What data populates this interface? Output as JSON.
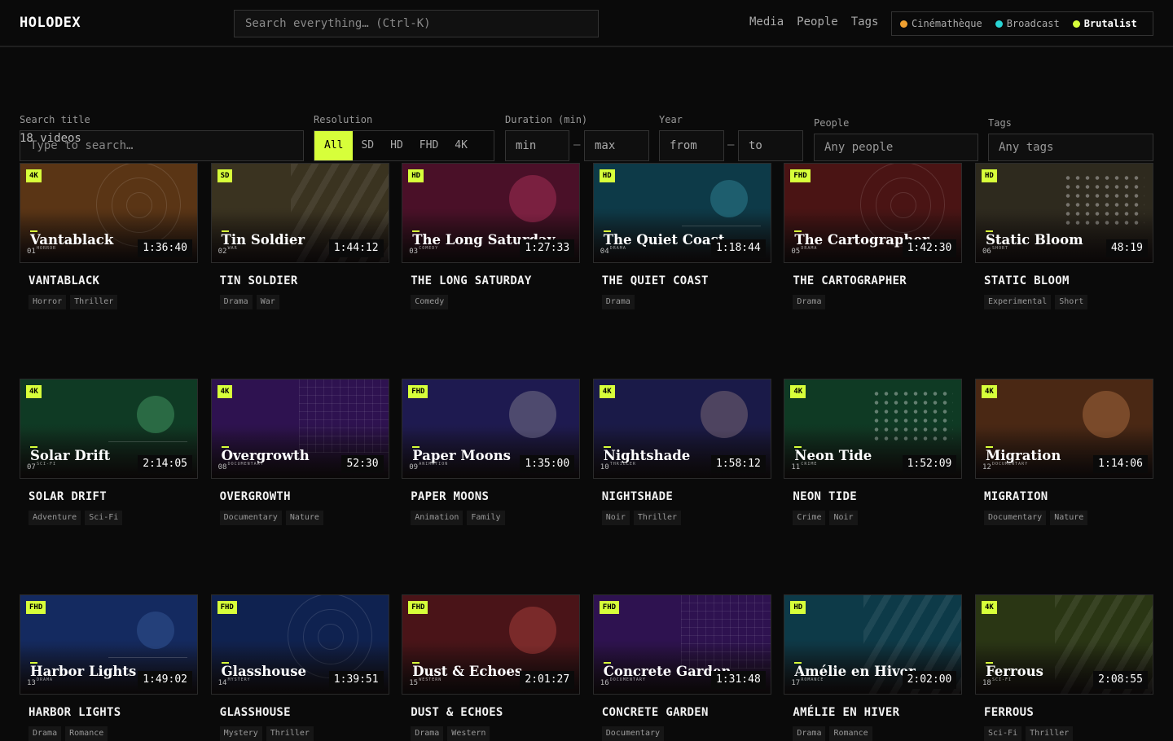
{
  "header": {
    "logo": "HOLODEX",
    "search_placeholder": "Search everything…  (Ctrl-K)",
    "nav": [
      "Media",
      "People",
      "Tags"
    ],
    "themes": [
      {
        "label": "Cinémathèque",
        "color": "#f0a030",
        "active": false
      },
      {
        "label": "Broadcast",
        "color": "#29d4d4",
        "active": false
      },
      {
        "label": "Brutalist",
        "color": "#d7ff3a",
        "active": true
      }
    ]
  },
  "filters": {
    "title_label": "Search title",
    "title_placeholder": "Type to search…",
    "resolution_label": "Resolution",
    "resolutions": [
      "All",
      "SD",
      "HD",
      "FHD",
      "4K"
    ],
    "resolution_selected": "All",
    "duration_label": "Duration (min)",
    "duration_min": "min",
    "duration_max": "max",
    "year_label": "Year",
    "year_from": "from",
    "year_to": "to",
    "people_label": "People",
    "people_placeholder": "Any people",
    "tags_label": "Tags",
    "tags_placeholder": "Any tags",
    "range_sep": "–"
  },
  "result_count": "18 videos",
  "videos": [
    {
      "num": "01",
      "res": "4K",
      "title": "Vantablack",
      "caps": "VANTABLACK",
      "genre": "HORROR",
      "duration": "1:36:40",
      "tags": [
        "Horror",
        "Thriller"
      ],
      "bg": "#5a3515",
      "deco": "rings",
      "accent": "#8a4a20"
    },
    {
      "num": "02",
      "res": "SD",
      "title": "Tin Soldier",
      "caps": "TIN SOLDIER",
      "genre": "WAR",
      "duration": "1:44:12",
      "tags": [
        "Drama",
        "War"
      ],
      "bg": "#3a3320",
      "deco": "stripes",
      "accent": "#6a5a30"
    },
    {
      "num": "03",
      "res": "HD",
      "title": "The Long Saturday",
      "caps": "THE LONG SATURDAY",
      "genre": "COMEDY",
      "duration": "1:27:33",
      "tags": [
        "Comedy"
      ],
      "bg": "#4a1028",
      "deco": "circle",
      "accent": "#7a2040"
    },
    {
      "num": "04",
      "res": "HD",
      "title": "The Quiet Coast",
      "caps": "THE QUIET COAST",
      "genre": "DRAMA",
      "duration": "1:18:44",
      "tags": [
        "Drama"
      ],
      "bg": "#0d3a48",
      "deco": "circle-line",
      "accent": "#1e5e6e"
    },
    {
      "num": "05",
      "res": "FHD",
      "title": "The Cartographer",
      "caps": "THE CARTOGRAPHER",
      "genre": "DRAMA",
      "duration": "1:42:30",
      "tags": [
        "Drama"
      ],
      "bg": "#4a1414",
      "deco": "rings",
      "accent": "#7a2020"
    },
    {
      "num": "06",
      "res": "HD",
      "title": "Static Bloom",
      "caps": "STATIC BLOOM",
      "genre": "SHORT",
      "duration": "48:19",
      "tags": [
        "Experimental",
        "Short"
      ],
      "bg": "#2e2a1e",
      "deco": "dots",
      "accent": "#c08040"
    },
    {
      "num": "07",
      "res": "4K",
      "title": "Solar Drift",
      "caps": "SOLAR DRIFT",
      "genre": "SCI-FI",
      "duration": "2:14:05",
      "tags": [
        "Adventure",
        "Sci-Fi"
      ],
      "bg": "#0f3a24",
      "deco": "circle-line",
      "accent": "#2a6a44"
    },
    {
      "num": "08",
      "res": "4K",
      "title": "Overgrowth",
      "caps": "OVERGROWTH",
      "genre": "DOCUMENTARY",
      "duration": "52:30",
      "tags": [
        "Documentary",
        "Nature"
      ],
      "bg": "#2e1250",
      "deco": "gridlines",
      "accent": "#50307a"
    },
    {
      "num": "09",
      "res": "FHD",
      "title": "Paper Moons",
      "caps": "PAPER MOONS",
      "genre": "ANIMATION",
      "duration": "1:35:00",
      "tags": [
        "Animation",
        "Family"
      ],
      "bg": "#1e1a50",
      "deco": "circle",
      "accent": "#4e4a6e"
    },
    {
      "num": "10",
      "res": "4K",
      "title": "Nightshade",
      "caps": "NIGHTSHADE",
      "genre": "THRILLER",
      "duration": "1:58:12",
      "tags": [
        "Noir",
        "Thriller"
      ],
      "bg": "#1a1a48",
      "deco": "circle",
      "accent": "#4e4460"
    },
    {
      "num": "11",
      "res": "4K",
      "title": "Neon Tide",
      "caps": "NEON TIDE",
      "genre": "CRIME",
      "duration": "1:52:09",
      "tags": [
        "Crime",
        "Noir"
      ],
      "bg": "#0f3a24",
      "deco": "dots",
      "accent": "#40a070"
    },
    {
      "num": "12",
      "res": "4K",
      "title": "Migration",
      "caps": "MIGRATION",
      "genre": "DOCUMENTARY",
      "duration": "1:14:06",
      "tags": [
        "Documentary",
        "Nature"
      ],
      "bg": "#4a2814",
      "deco": "circle",
      "accent": "#7a4a2a"
    },
    {
      "num": "13",
      "res": "FHD",
      "title": "Harbor Lights",
      "caps": "HARBOR LIGHTS",
      "genre": "DRAMA",
      "duration": "1:49:02",
      "tags": [
        "Drama",
        "Romance"
      ],
      "bg": "#142a60",
      "deco": "circle-line",
      "accent": "#24407a"
    },
    {
      "num": "14",
      "res": "FHD",
      "title": "Glasshouse",
      "caps": "GLASSHOUSE",
      "genre": "MYSTERY",
      "duration": "1:39:51",
      "tags": [
        "Mystery",
        "Thriller"
      ],
      "bg": "#0f2250",
      "deco": "rings",
      "accent": "#1c3470"
    },
    {
      "num": "15",
      "res": "FHD",
      "title": "Dust & Echoes",
      "caps": "DUST & ECHOES",
      "genre": "WESTERN",
      "duration": "2:01:27",
      "tags": [
        "Drama",
        "Western"
      ],
      "bg": "#4a1418",
      "deco": "circle",
      "accent": "#7a2a2a"
    },
    {
      "num": "16",
      "res": "FHD",
      "title": "Concrete Garden",
      "caps": "CONCRETE GARDEN",
      "genre": "DOCUMENTARY",
      "duration": "1:31:48",
      "tags": [
        "Documentary"
      ],
      "bg": "#2e1250",
      "deco": "gridlines",
      "accent": "#50307a"
    },
    {
      "num": "17",
      "res": "HD",
      "title": "Amélie en Hiver",
      "caps": "AMÉLIE EN HIVER",
      "genre": "ROMANCE",
      "duration": "2:02:00",
      "tags": [
        "Drama",
        "Romance"
      ],
      "bg": "#0d3a48",
      "deco": "stripes",
      "accent": "#1e5e6e"
    },
    {
      "num": "18",
      "res": "4K",
      "title": "Ferrous",
      "caps": "FERROUS",
      "genre": "SCI-FI",
      "duration": "2:08:55",
      "tags": [
        "Sci-Fi",
        "Thriller"
      ],
      "bg": "#2a3614",
      "deco": "stripes",
      "accent": "#4a5a24"
    }
  ]
}
